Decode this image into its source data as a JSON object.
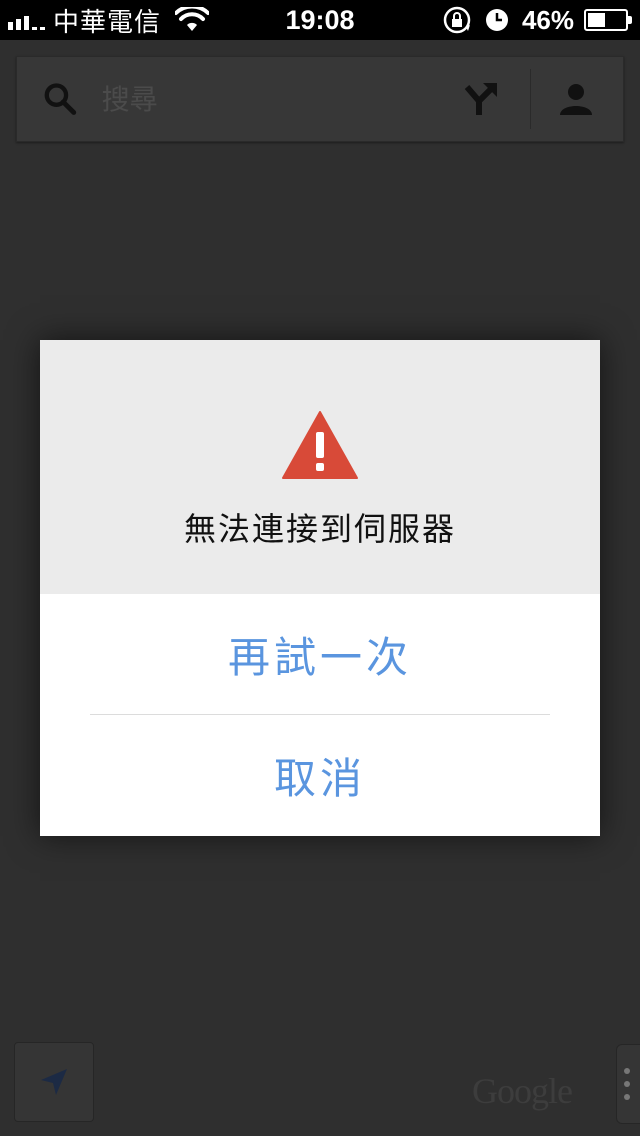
{
  "status_bar": {
    "carrier": "中華電信",
    "time": "19:08",
    "battery_percent": "46%",
    "battery_level": 0.46
  },
  "search": {
    "placeholder": "搜尋",
    "value": ""
  },
  "dialog": {
    "message": "無法連接到伺服器",
    "retry_label": "再試一次",
    "cancel_label": "取消",
    "accent_color": "#5a95df",
    "warning_color": "#d84a38"
  },
  "map": {
    "logo_text": "Google"
  }
}
